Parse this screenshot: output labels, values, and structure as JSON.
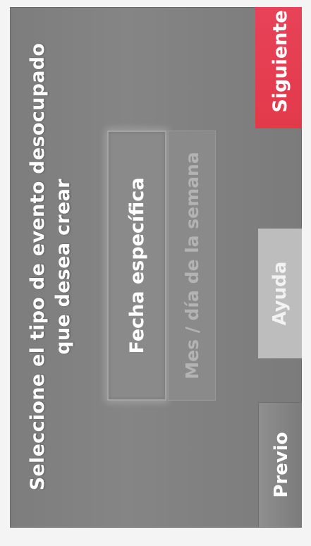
{
  "title": "Seleccione el tipo de evento desocupado que desea crear",
  "options": {
    "specific_date": "Fecha específica",
    "month_weekday": "Mes / día de la semana"
  },
  "buttons": {
    "previous": "Previo",
    "help": "Ayuda",
    "next": "Siguiente"
  },
  "colors": {
    "next_button": "#e33a4a",
    "background": "#7d7d7d"
  }
}
